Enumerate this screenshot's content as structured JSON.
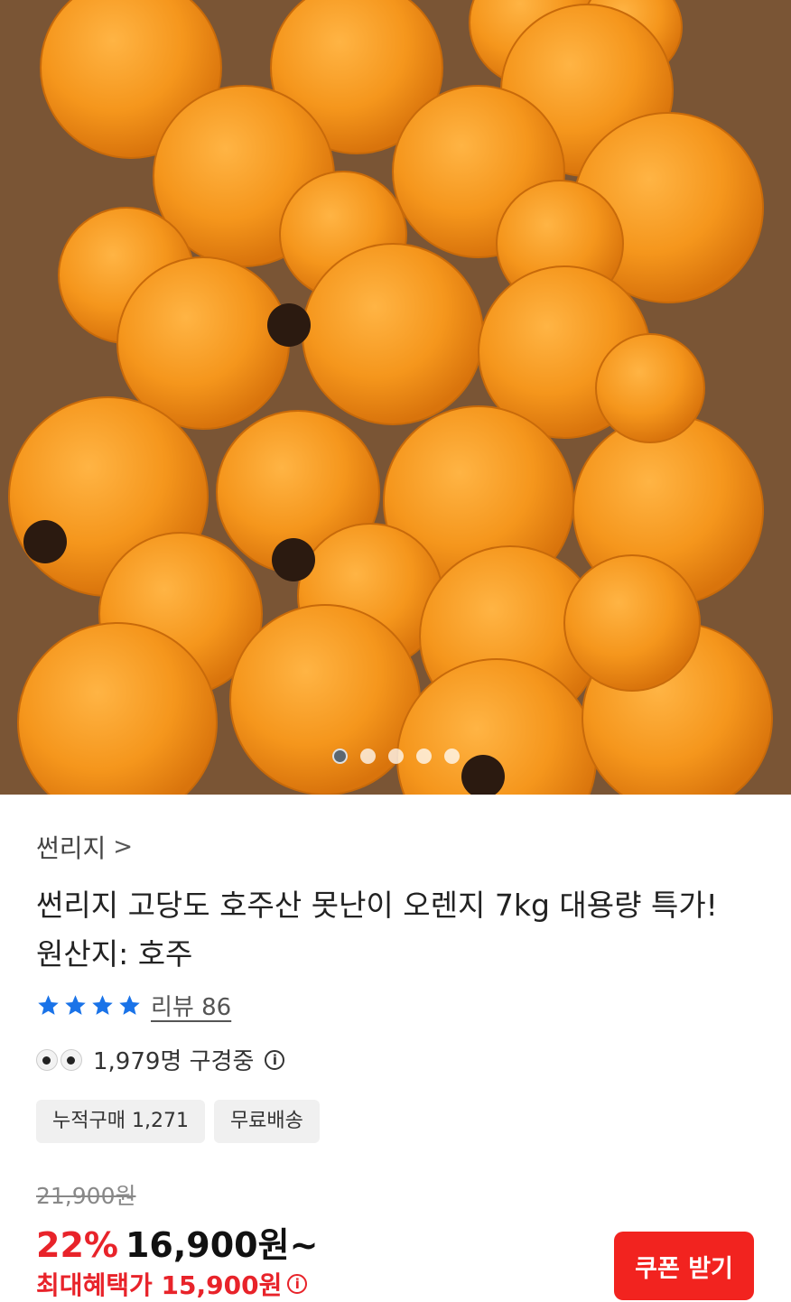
{
  "product": {
    "brand": "썬리지",
    "title_line1": "썬리지 고당도 호주산 못난이 오렌지 7kg 대용량 특가!",
    "title_line2": "원산지: 호주",
    "rating_stars": 4,
    "review_label": "리뷰 86",
    "viewing_text": "1,979명 구경중",
    "tags": [
      "누적구매 1,271",
      "무료배송"
    ],
    "original_price": "21,900원",
    "discount": "22%",
    "price": "16,900원~",
    "max_benefit": "최대혜택가 15,900원",
    "coupon_button": "쿠폰 받기"
  },
  "carousel": {
    "total": 5,
    "active_index": 0
  },
  "colors": {
    "accent": "#f2231f",
    "discount": "#e8232a",
    "star": "#1a73e8"
  },
  "icons": {
    "brand_chevron": "chevron-right-icon",
    "star": "star-icon",
    "eyes": "eyes-icon",
    "info": "info-icon"
  }
}
